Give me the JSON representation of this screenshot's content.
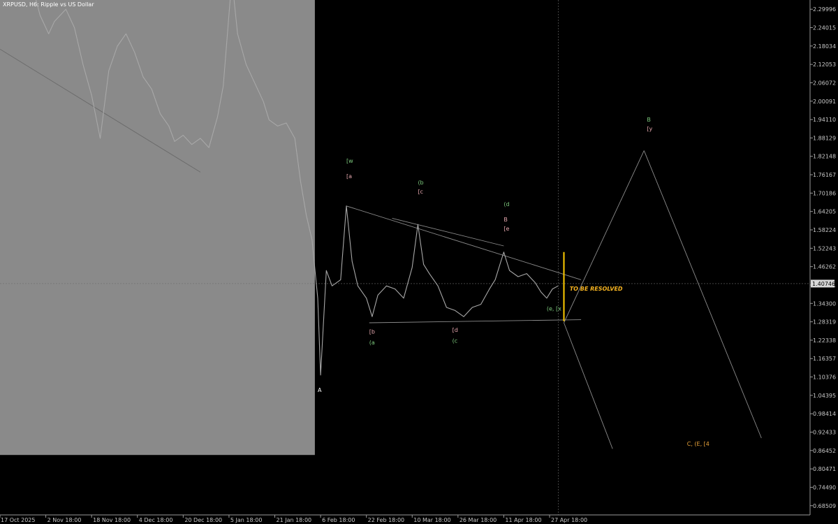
{
  "title": "XRPUSD, H6:  Ripple vs US Dollar",
  "chart_data": {
    "type": "line",
    "symbol": "XRPUSD",
    "timeframe": "H6",
    "description": "Ripple vs US Dollar",
    "ylim": [
      0.655,
      2.33
    ],
    "y_ticks": [
      "2.29996",
      "2.24015",
      "2.18034",
      "2.12053",
      "2.06072",
      "2.00091",
      "1.94110",
      "1.88129",
      "1.82148",
      "1.76167",
      "1.70186",
      "1.64205",
      "1.58224",
      "1.52243",
      "1.46262",
      "1.40281",
      "1.34300",
      "1.28319",
      "1.22338",
      "1.16357",
      "1.10376",
      "1.04395",
      "0.98414",
      "0.92433",
      "0.86452",
      "0.80471",
      "0.74490",
      "0.68509"
    ],
    "current_price": "1.40746",
    "x_ticks": [
      "17 Oct 2025",
      "2 Nov 18:00",
      "18 Nov 18:00",
      "4 Dec 18:00",
      "20 Dec 18:00",
      "5 Jan 18:00",
      "21 Jan 18:00",
      "6 Feb 18:00",
      "22 Feb 18:00",
      "10 Mar 18:00",
      "26 Mar 18:00",
      "11 Apr 18:00",
      "27 Apr 18:00"
    ],
    "x_range": [
      "2025-10-17",
      "2026-07-27"
    ],
    "price_series": [
      {
        "date": "2025-10-20",
        "price": 2.45
      },
      {
        "date": "2025-10-24",
        "price": 2.36
      },
      {
        "date": "2025-10-27",
        "price": 2.42
      },
      {
        "date": "2025-10-31",
        "price": 2.28
      },
      {
        "date": "2025-11-03",
        "price": 2.22
      },
      {
        "date": "2025-11-05",
        "price": 2.26
      },
      {
        "date": "2025-11-09",
        "price": 2.3
      },
      {
        "date": "2025-11-12",
        "price": 2.24
      },
      {
        "date": "2025-11-15",
        "price": 2.12
      },
      {
        "date": "2025-11-18",
        "price": 2.02
      },
      {
        "date": "2025-11-21",
        "price": 1.88
      },
      {
        "date": "2025-11-24",
        "price": 2.1
      },
      {
        "date": "2025-11-27",
        "price": 2.18
      },
      {
        "date": "2025-11-30",
        "price": 2.22
      },
      {
        "date": "2025-12-03",
        "price": 2.16
      },
      {
        "date": "2025-12-06",
        "price": 2.08
      },
      {
        "date": "2025-12-09",
        "price": 2.04
      },
      {
        "date": "2025-12-12",
        "price": 1.96
      },
      {
        "date": "2025-12-15",
        "price": 1.92
      },
      {
        "date": "2025-12-17",
        "price": 1.87
      },
      {
        "date": "2025-12-20",
        "price": 1.89
      },
      {
        "date": "2025-12-23",
        "price": 1.86
      },
      {
        "date": "2025-12-26",
        "price": 1.88
      },
      {
        "date": "2025-12-29",
        "price": 1.85
      },
      {
        "date": "2026-01-01",
        "price": 1.95
      },
      {
        "date": "2026-01-03",
        "price": 2.05
      },
      {
        "date": "2026-01-06",
        "price": 2.4
      },
      {
        "date": "2026-01-08",
        "price": 2.22
      },
      {
        "date": "2026-01-11",
        "price": 2.12
      },
      {
        "date": "2026-01-14",
        "price": 2.06
      },
      {
        "date": "2026-01-17",
        "price": 2.0
      },
      {
        "date": "2026-01-19",
        "price": 1.94
      },
      {
        "date": "2026-01-22",
        "price": 1.92
      },
      {
        "date": "2026-01-25",
        "price": 1.93
      },
      {
        "date": "2026-01-28",
        "price": 1.88
      },
      {
        "date": "2026-01-30",
        "price": 1.74
      },
      {
        "date": "2026-02-01",
        "price": 1.63
      },
      {
        "date": "2026-02-03",
        "price": 1.55
      },
      {
        "date": "2026-02-05",
        "price": 1.36
      },
      {
        "date": "2026-02-06",
        "price": 1.11
      },
      {
        "date": "2026-02-08",
        "price": 1.45
      },
      {
        "date": "2026-02-10",
        "price": 1.4
      },
      {
        "date": "2026-02-13",
        "price": 1.42
      },
      {
        "date": "2026-02-15",
        "price": 1.66
      },
      {
        "date": "2026-02-17",
        "price": 1.48
      },
      {
        "date": "2026-02-19",
        "price": 1.4
      },
      {
        "date": "2026-02-22",
        "price": 1.36
      },
      {
        "date": "2026-02-24",
        "price": 1.3
      },
      {
        "date": "2026-02-26",
        "price": 1.37
      },
      {
        "date": "2026-03-01",
        "price": 1.4
      },
      {
        "date": "2026-03-04",
        "price": 1.39
      },
      {
        "date": "2026-03-07",
        "price": 1.36
      },
      {
        "date": "2026-03-10",
        "price": 1.46
      },
      {
        "date": "2026-03-12",
        "price": 1.6
      },
      {
        "date": "2026-03-14",
        "price": 1.47
      },
      {
        "date": "2026-03-16",
        "price": 1.44
      },
      {
        "date": "2026-03-19",
        "price": 1.4
      },
      {
        "date": "2026-03-22",
        "price": 1.33
      },
      {
        "date": "2026-03-25",
        "price": 1.32
      },
      {
        "date": "2026-03-28",
        "price": 1.3
      },
      {
        "date": "2026-03-31",
        "price": 1.33
      },
      {
        "date": "2026-04-03",
        "price": 1.34
      },
      {
        "date": "2026-04-06",
        "price": 1.39
      },
      {
        "date": "2026-04-08",
        "price": 1.42
      },
      {
        "date": "2026-04-11",
        "price": 1.51
      },
      {
        "date": "2026-04-13",
        "price": 1.45
      },
      {
        "date": "2026-04-16",
        "price": 1.43
      },
      {
        "date": "2026-04-19",
        "price": 1.44
      },
      {
        "date": "2026-04-22",
        "price": 1.41
      },
      {
        "date": "2026-04-24",
        "price": 1.38
      },
      {
        "date": "2026-04-26",
        "price": 1.36
      },
      {
        "date": "2026-04-28",
        "price": 1.39
      },
      {
        "date": "2026-04-30",
        "price": 1.4
      }
    ],
    "trendlines": [
      {
        "from": {
          "date": "2025-10-17",
          "price": 2.17
        },
        "to": {
          "date": "2025-12-26",
          "price": 1.77
        },
        "color": "#6a6a6a"
      },
      {
        "from": {
          "date": "2026-02-15",
          "price": 1.66
        },
        "to": {
          "date": "2026-05-08",
          "price": 1.42
        },
        "color": "#8c8c8c"
      },
      {
        "from": {
          "date": "2026-03-03",
          "price": 1.62
        },
        "to": {
          "date": "2026-04-11",
          "price": 1.53
        },
        "color": "#8c8c8c"
      },
      {
        "from": {
          "date": "2026-02-23",
          "price": 1.28
        },
        "to": {
          "date": "2026-05-08",
          "price": 1.29
        },
        "color": "#8c8c8c"
      },
      {
        "from": {
          "date": "2026-05-02",
          "price": 1.28
        },
        "to": {
          "date": "2026-05-30",
          "price": 1.84
        },
        "color": "#8c8c8c"
      },
      {
        "from": {
          "date": "2026-05-30",
          "price": 1.84
        },
        "to": {
          "date": "2026-07-10",
          "price": 0.905
        },
        "color": "#8c8c8c"
      },
      {
        "from": {
          "date": "2026-05-02",
          "price": 1.28
        },
        "to": {
          "date": "2026-05-19",
          "price": 0.87
        },
        "color": "#8c8c8c"
      }
    ],
    "annotations": [
      {
        "text": "A",
        "date": "2026-02-05",
        "price": 1.055,
        "color": "#ffffff"
      },
      {
        "text": "[w",
        "date": "2026-02-15",
        "price": 1.8,
        "color": "#7ecb7e"
      },
      {
        "text": "[a",
        "date": "2026-02-15",
        "price": 1.75,
        "color": "#e6a7ae"
      },
      {
        "text": "[b",
        "date": "2026-02-23",
        "price": 1.245,
        "color": "#e6a7ae"
      },
      {
        "text": "(a",
        "date": "2026-02-23",
        "price": 1.21,
        "color": "#7ecb7e"
      },
      {
        "text": "(b",
        "date": "2026-03-12",
        "price": 1.73,
        "color": "#7ecb7e"
      },
      {
        "text": "[c",
        "date": "2026-03-12",
        "price": 1.7,
        "color": "#e6a7ae"
      },
      {
        "text": "[d",
        "date": "2026-03-24",
        "price": 1.25,
        "color": "#e6a7ae"
      },
      {
        "text": "(c",
        "date": "2026-03-24",
        "price": 1.215,
        "color": "#7ecb7e"
      },
      {
        "text": "(d",
        "date": "2026-04-11",
        "price": 1.66,
        "color": "#7ecb7e"
      },
      {
        "text": "B",
        "date": "2026-04-11",
        "price": 1.61,
        "color": "#e6a7ae"
      },
      {
        "text": "[e",
        "date": "2026-04-11",
        "price": 1.58,
        "color": "#e6a7ae"
      },
      {
        "text": "(e, [x",
        "date": "2026-04-26",
        "price": 1.32,
        "color": "#7ecb7e"
      },
      {
        "text": "B",
        "date": "2026-05-31",
        "price": 1.935,
        "color": "#7ecb7e"
      },
      {
        "text": "[y",
        "date": "2026-05-31",
        "price": 1.905,
        "color": "#e6a7ae"
      },
      {
        "text": "C, (E, [4",
        "date": "2026-06-14",
        "price": 0.88,
        "color": "#e8a33a"
      },
      {
        "text": "TO BE RESOLVED",
        "date": "2026-05-04",
        "price": 1.385,
        "color": "#f5b321"
      }
    ],
    "resolution_marker": {
      "date": "2026-05-02",
      "price_top": 1.51,
      "price_bottom": 1.285,
      "color": "#ffcc00"
    },
    "shaded_history_until": "2026-02-04",
    "grid": false
  }
}
